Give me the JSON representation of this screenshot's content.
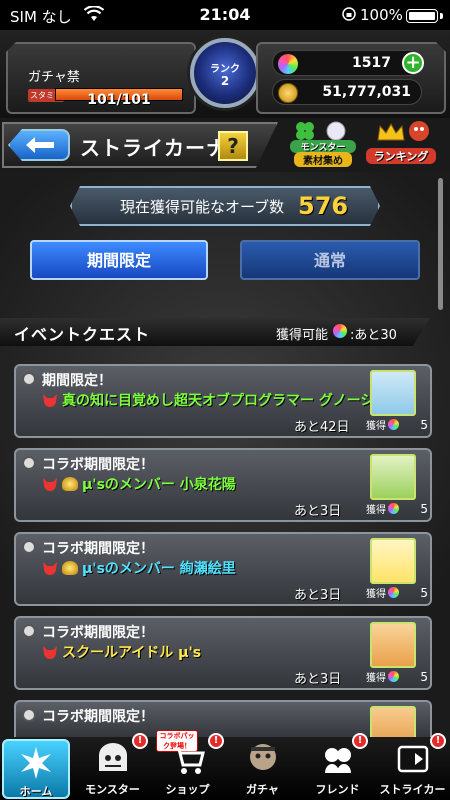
{
  "status_bar": {
    "carrier": "SIM なし",
    "time": "21:04",
    "battery": "100%"
  },
  "player": {
    "name": "ガチャ禁",
    "stamina_label": "スタミナ",
    "stamina_text": "101/101",
    "stamina_fraction": 1.0,
    "rank_label": "ランク",
    "rank_value": "2"
  },
  "currency": {
    "orbs": "1517",
    "coins": "51,777,031"
  },
  "title_bar": {
    "title": "ストライカーナビ",
    "help_symbol": "?",
    "material_label_top": "モンスター",
    "material_label_bottom": "素材集め",
    "ranking_label": "ランキング"
  },
  "orb_box": {
    "label": "現在獲得可能なオーブ数",
    "count": "576"
  },
  "tabs": [
    {
      "label": "期間限定",
      "active": true
    },
    {
      "label": "通常",
      "active": false
    }
  ],
  "section": {
    "title": "イベントクエスト",
    "available_label": "獲得可能",
    "remaining": ":あと30"
  },
  "quests": [
    {
      "kind": "期間限定！",
      "name": "真の知に目覚めし超天オブプログラマー グノーシス",
      "name_color": "#7dff3e",
      "coin": false,
      "remaining": "あと42日",
      "reward_label": "獲得",
      "reward_count": "5",
      "thumb_color": "#8ec9e8"
    },
    {
      "kind": "コラボ期間限定！",
      "name": "μ'sのメンバー 小泉花陽",
      "name_color": "#7dff3e",
      "coin": true,
      "remaining": "あと3日",
      "reward_label": "獲得",
      "reward_count": "5",
      "thumb_color": "#9bd05c"
    },
    {
      "kind": "コラボ期間限定！",
      "name": "μ'sのメンバー 絢瀬絵里",
      "name_color": "#4fe3ff",
      "coin": true,
      "remaining": "あと3日",
      "reward_label": "獲得",
      "reward_count": "5",
      "thumb_color": "#ffe36a"
    },
    {
      "kind": "コラボ期間限定！",
      "name": "スクールアイドル μ's",
      "name_color": "#ffe84a",
      "coin": false,
      "remaining": "あと3日",
      "reward_label": "獲得",
      "reward_count": "5",
      "thumb_color": "#e9a04a"
    },
    {
      "kind": "コラボ期間限定！",
      "name": "",
      "name_color": "#7dff3e",
      "coin": false,
      "remaining": "",
      "reward_label": "",
      "reward_count": "",
      "thumb_color": "#e6a050"
    }
  ],
  "bottom_nav": [
    {
      "label": "ホーム",
      "badge": false
    },
    {
      "label": "モンスター",
      "badge": true
    },
    {
      "label": "ショップ",
      "badge": true
    },
    {
      "label": "ガチャ",
      "badge": false
    },
    {
      "label": "フレンド",
      "badge": true
    },
    {
      "label": "ストライカー",
      "badge": true
    }
  ],
  "shop_banner": "コラボパック登場！"
}
